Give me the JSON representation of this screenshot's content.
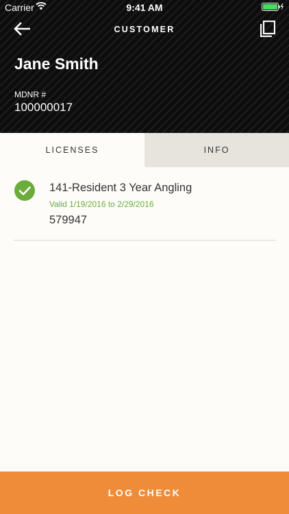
{
  "status_bar": {
    "carrier": "Carrier",
    "time": "9:41 AM"
  },
  "nav": {
    "title": "CUSTOMER"
  },
  "customer": {
    "name": "Jane Smith",
    "id_label": "MDNR #",
    "id_value": "100000017"
  },
  "tabs": [
    {
      "label": "LICENSES",
      "selected": true
    },
    {
      "label": "INFO",
      "selected": false
    }
  ],
  "licenses": [
    {
      "name": "141-Resident 3 Year Angling",
      "validity": "Valid 1/19/2016 to 2/29/2016",
      "number": "579947",
      "status_icon": "check-circle-icon"
    }
  ],
  "actions": {
    "log_check": "LOG CHECK"
  },
  "colors": {
    "accent": "#ef8c3a",
    "valid_green": "#6aad3a",
    "header_bg": "#0c0d0c"
  }
}
